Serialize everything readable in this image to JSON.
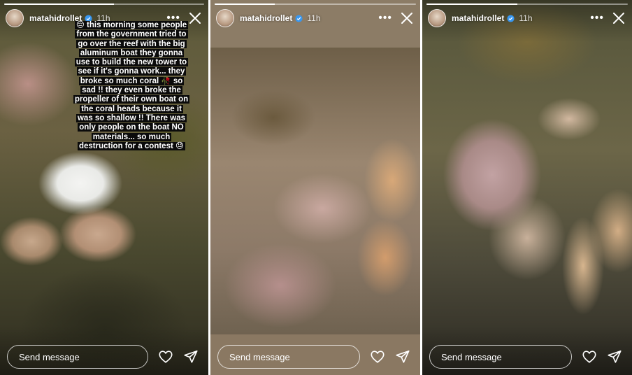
{
  "stories": [
    {
      "username": "matahidrollet",
      "time": "11h",
      "caption": "😔 this morning some people from the government tried to go over the reef with the big aluminum boat they gonna use to build the new tower to see if it's gonna work... they broke so much coral 🥀 so sad !! they even broke the propeller of their own boat on the coral heads because it was so shallow !! There was only people on the boat NO materials... so much destruction for a contest 😓",
      "send_placeholder": "Send message",
      "progress": 0.55
    },
    {
      "username": "matahidrollet",
      "time": "11h",
      "send_placeholder": "Send message",
      "progress": 0.3
    },
    {
      "username": "matahidrollet",
      "time": "11h",
      "send_placeholder": "Send message",
      "progress": 0.45
    }
  ],
  "icons": {
    "more": "more-icon",
    "close": "close-icon",
    "verified": "verified-badge-icon",
    "like": "heart-icon",
    "share": "send-icon"
  },
  "colors": {
    "verified": "#3897f0",
    "caption_background": "#0b0b0b",
    "text": "#ffffff"
  }
}
